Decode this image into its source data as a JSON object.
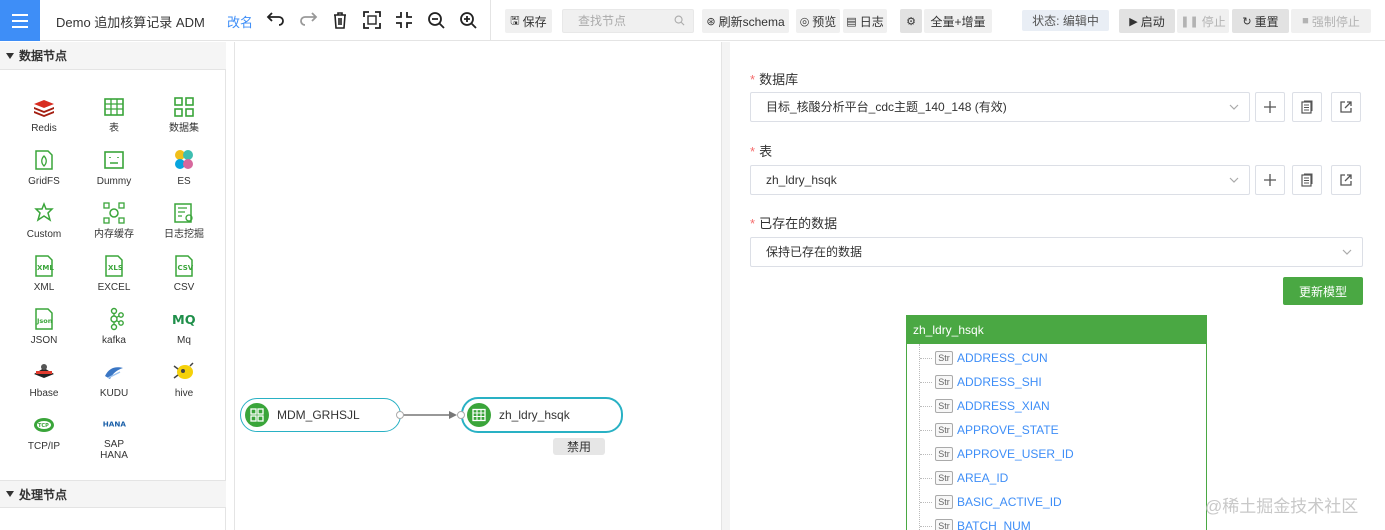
{
  "toolbar": {
    "title": "Demo 追加核算记录 ADM",
    "rename": "改名",
    "save": "保存",
    "search_placeholder": "查找节点",
    "refresh_schema": "刷新schema",
    "preview": "预览",
    "log": "日志",
    "sync_mode": "全量+增量",
    "status": "状态: 编辑中",
    "start": "启动",
    "stop": "停止",
    "reset": "重置",
    "force_stop": "强制停止"
  },
  "left_panel": {
    "data_nodes_title": "数据节点",
    "process_nodes_title": "处理节点",
    "nodes": [
      {
        "label": "Redis",
        "icon": "redis-icon"
      },
      {
        "label": "表",
        "icon": "table-icon"
      },
      {
        "label": "数据集",
        "icon": "dataset-icon"
      },
      {
        "label": "GridFS",
        "icon": "gridfs-icon"
      },
      {
        "label": "Dummy",
        "icon": "dummy-icon"
      },
      {
        "label": "ES",
        "icon": "elasticsearch-icon"
      },
      {
        "label": "Custom",
        "icon": "custom-icon"
      },
      {
        "label": "内存缓存",
        "icon": "memory-cache-icon"
      },
      {
        "label": "日志挖掘",
        "icon": "log-mining-icon"
      },
      {
        "label": "XML",
        "icon": "xml-icon"
      },
      {
        "label": "EXCEL",
        "icon": "excel-icon"
      },
      {
        "label": "CSV",
        "icon": "csv-icon"
      },
      {
        "label": "JSON",
        "icon": "json-icon"
      },
      {
        "label": "kafka",
        "icon": "kafka-icon"
      },
      {
        "label": "Mq",
        "icon": "mq-icon"
      },
      {
        "label": "Hbase",
        "icon": "hbase-icon"
      },
      {
        "label": "KUDU",
        "icon": "kudu-icon"
      },
      {
        "label": "hive",
        "icon": "hive-icon"
      },
      {
        "label": "TCP/IP",
        "icon": "tcpip-icon"
      },
      {
        "label": "SAP HANA",
        "icon": "sap-hana-icon"
      }
    ]
  },
  "canvas": {
    "source_node": "MDM_GRHSJL",
    "target_node": "zh_ldry_hsqk",
    "disabled_tag": "禁用"
  },
  "right_panel": {
    "database_label": "数据库",
    "database_value": "目标_核酸分析平台_cdc主题_140_148 (有效)",
    "table_label": "表",
    "table_value": "zh_ldry_hsqk",
    "existing_data_label": "已存在的数据",
    "existing_data_value": "保持已存在的数据",
    "update_model": "更新模型",
    "model": {
      "title": "zh_ldry_hsqk",
      "type_badge": "Str",
      "fields": [
        "ADDRESS_CUN",
        "ADDRESS_SHI",
        "ADDRESS_XIAN",
        "APPROVE_STATE",
        "APPROVE_USER_ID",
        "AREA_ID",
        "BASIC_ACTIVE_ID",
        "BATCH_NUM"
      ]
    }
  },
  "watermark": "@稀土掘金技术社区",
  "colors": {
    "accent_blue": "#3e8ef7",
    "node_green": "#3aa53a",
    "node_border": "#29b1c4",
    "update_green": "#4aa843"
  }
}
